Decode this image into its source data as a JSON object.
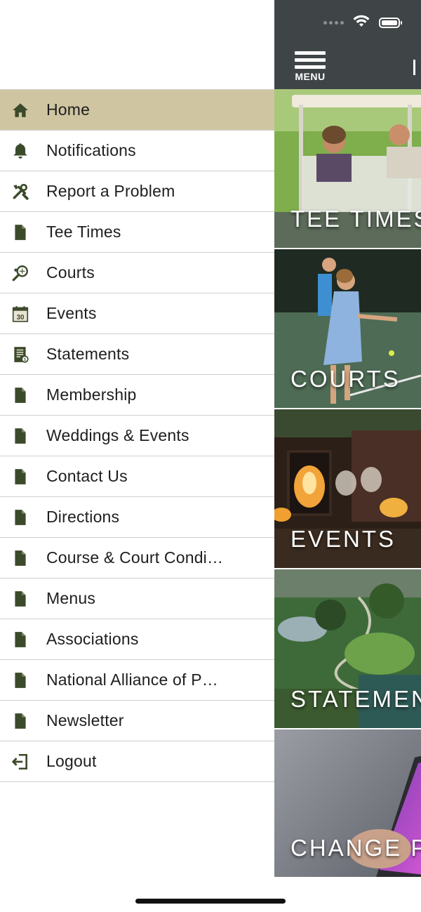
{
  "menu": {
    "items": [
      {
        "label": "Home",
        "icon": "home-icon",
        "active": true
      },
      {
        "label": "Notifications",
        "icon": "bell-icon"
      },
      {
        "label": "Report a Problem",
        "icon": "tools-icon"
      },
      {
        "label": "Tee Times",
        "icon": "document-icon"
      },
      {
        "label": "Courts",
        "icon": "tennis-racket-icon"
      },
      {
        "label": "Events",
        "icon": "calendar-icon"
      },
      {
        "label": "Statements",
        "icon": "statement-icon"
      },
      {
        "label": "Membership",
        "icon": "document-icon"
      },
      {
        "label": "Weddings & Events",
        "icon": "document-icon"
      },
      {
        "label": "Contact Us",
        "icon": "document-icon"
      },
      {
        "label": "Directions",
        "icon": "document-icon"
      },
      {
        "label": "Course & Court Condi…",
        "icon": "document-icon"
      },
      {
        "label": "Menus",
        "icon": "document-icon"
      },
      {
        "label": "Associations",
        "icon": "document-icon"
      },
      {
        "label": "National Alliance of P…",
        "icon": "document-icon"
      },
      {
        "label": "Newsletter",
        "icon": "document-icon"
      },
      {
        "label": "Logout",
        "icon": "logout-icon"
      }
    ],
    "calendar_day": "30"
  },
  "topbar": {
    "menu_label": "MENU"
  },
  "tiles": [
    {
      "caption": "TEE TIMES"
    },
    {
      "caption": "COURTS"
    },
    {
      "caption": "EVENTS"
    },
    {
      "caption": "STATEMEN"
    },
    {
      "caption": "CHANGE PA"
    }
  ],
  "colors": {
    "active_row": "#cfc5a1",
    "icon_green": "#3b4a2a",
    "topbar": "#3f4547"
  }
}
